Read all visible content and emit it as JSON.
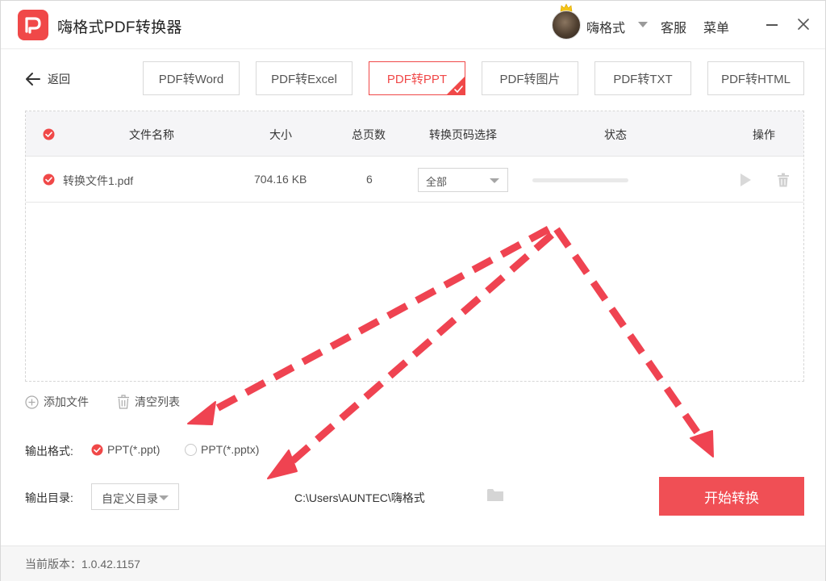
{
  "app": {
    "title": "嗨格式PDF转换器"
  },
  "header": {
    "username": "嗨格式",
    "service_label": "客服",
    "menu_label": "菜单"
  },
  "nav": {
    "back_label": "返回"
  },
  "tabs": [
    {
      "label": "PDF转Word",
      "active": false
    },
    {
      "label": "PDF转Excel",
      "active": false
    },
    {
      "label": "PDF转PPT",
      "active": true
    },
    {
      "label": "PDF转图片",
      "active": false
    },
    {
      "label": "PDF转TXT",
      "active": false
    },
    {
      "label": "PDF转HTML",
      "active": false
    }
  ],
  "table": {
    "columns": {
      "name": "文件名称",
      "size": "大小",
      "pages": "总页数",
      "page_range": "转换页码选择",
      "status": "状态",
      "actions": "操作"
    },
    "rows": [
      {
        "name": "转换文件1.pdf",
        "size": "704.16 KB",
        "pages": "6",
        "page_range": "全部",
        "progress": 0
      }
    ]
  },
  "actions": {
    "add_file": "添加文件",
    "clear_list": "清空列表"
  },
  "output": {
    "format_label": "输出格式:",
    "format_options": [
      {
        "label": "PPT(*.ppt)",
        "checked": true
      },
      {
        "label": "PPT(*.pptx)",
        "checked": false
      }
    ],
    "dir_label": "输出目录:",
    "dir_mode": "自定义目录",
    "dir_path": "C:\\Users\\AUNTEC\\嗨格式"
  },
  "start_button": "开始转换",
  "footer": {
    "version": "当前版本：1.0.42.1157"
  },
  "colors": {
    "accent": "#f04848",
    "start_button": "#f04f55",
    "annotation_arrow": "#ef4351"
  },
  "icons": [
    "app-logo-icon",
    "crown-icon",
    "back-arrow-icon",
    "check-icon",
    "play-icon",
    "trash-icon",
    "plus-circle-icon",
    "folder-icon",
    "minimize-icon",
    "close-icon"
  ]
}
